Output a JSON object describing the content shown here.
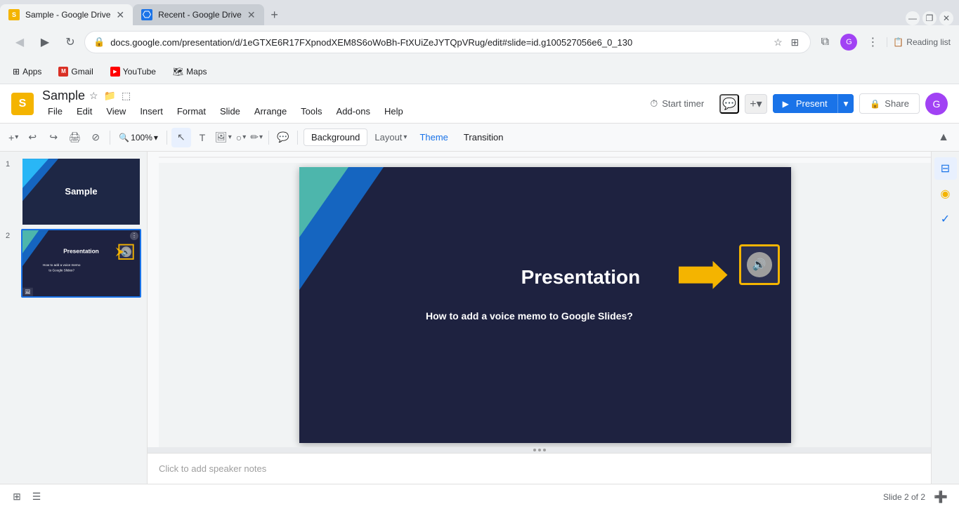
{
  "browser": {
    "tabs": [
      {
        "id": "tab1",
        "title": "Sample - Google Drive",
        "active": true,
        "favicon": "sample"
      },
      {
        "id": "tab2",
        "title": "Recent - Google Drive",
        "active": false,
        "favicon": "drive"
      }
    ],
    "new_tab_label": "+",
    "url": "docs.google.com/presentation/d/1eGTXE6R17FXpnodXEM8S6oWoBh-FtXUiZeJYTQpVRug/edit#slide=id.g100527056e6_0_130",
    "bookmarks": [
      "Apps",
      "Gmail",
      "YouTube",
      "Maps"
    ],
    "nav": {
      "back_disabled": false,
      "forward_disabled": false
    }
  },
  "app": {
    "logo_letter": "S",
    "title": "Sample",
    "menu_items": [
      "File",
      "Edit",
      "View",
      "Insert",
      "Format",
      "Slide",
      "Arrange",
      "Tools",
      "Add-ons",
      "Help"
    ],
    "header_buttons": {
      "start_timer": "Start timer",
      "present": "Present",
      "share": "Share"
    },
    "toolbar": {
      "zoom_level": "100%",
      "background_label": "Background",
      "layout_label": "Layout",
      "theme_label": "Theme",
      "transition_label": "Transition"
    },
    "slides": [
      {
        "num": "1",
        "title": "Sample"
      },
      {
        "num": "2",
        "title": "Presentation"
      }
    ],
    "current_slide": {
      "title": "Presentation",
      "subtitle": "How to add a voice memo to Google Slides?",
      "has_audio": true
    },
    "speaker_notes_placeholder": "Click to add speaker notes"
  },
  "icons": {
    "back": "◀",
    "forward": "▶",
    "reload": "↻",
    "star": "☆",
    "puzzle": "⊞",
    "account": "👤",
    "menu": "⋮",
    "undo": "↩",
    "redo": "↪",
    "print": "🖨",
    "move": "↕",
    "cursor": "↖",
    "select": "⬚",
    "image": "🖼",
    "shapes": "○",
    "pen": "✏",
    "chevron_down": "▾",
    "chevron_up": "▴",
    "collapse": "▲",
    "grid_view": "⊞",
    "list_view": "☰",
    "plus": "+",
    "audio": "🔊",
    "lock": "🔒"
  }
}
